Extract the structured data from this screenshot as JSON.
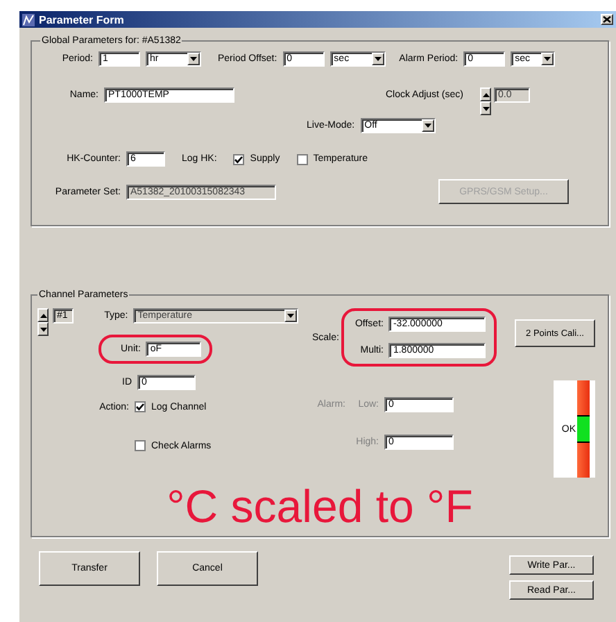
{
  "window": {
    "title": "Parameter Form"
  },
  "global": {
    "title": "Global Parameters for: #A51382",
    "period": {
      "label": "Period:",
      "value": "1",
      "unit": "hr"
    },
    "period_offset": {
      "label": "Period Offset:",
      "value": "0",
      "unit": "sec"
    },
    "alarm_period": {
      "label": "Alarm Period:",
      "value": "0",
      "unit": "sec"
    },
    "name": {
      "label": "Name:",
      "value": "PT1000TEMP"
    },
    "clock_adjust": {
      "label": "Clock Adjust (sec)",
      "value": "0.0",
      "disabled": true
    },
    "live_mode": {
      "label": "Live-Mode:",
      "value": "Off"
    },
    "hk_counter": {
      "label": "HK-Counter:",
      "value": "6"
    },
    "log_hk": {
      "label": "Log HK:",
      "options": [
        {
          "label": "Supply",
          "checked": true
        },
        {
          "label": "Temperature",
          "checked": false
        }
      ]
    },
    "parameter_set": {
      "label": "Parameter Set:",
      "value": "A51382_20100315082343",
      "disabled": true
    },
    "gprs_button": {
      "label": "GPRS/GSM Setup...",
      "disabled": true
    }
  },
  "channel": {
    "title": "Channel Parameters",
    "number": "#1",
    "type": {
      "label": "Type:",
      "value": "Temperature",
      "disabled": true
    },
    "unit": {
      "label": "Unit:",
      "value": "oF",
      "highlighted": true
    },
    "id": {
      "label": "ID",
      "value": "0"
    },
    "action": {
      "label": "Action:",
      "option": {
        "label": "Log Channel",
        "checked": true
      }
    },
    "check_alarms": {
      "label": "Check Alarms",
      "checked": false
    },
    "scale": {
      "label": "Scale:",
      "highlighted": true,
      "offset": {
        "label": "Offset:",
        "value": "-32.000000"
      },
      "multi": {
        "label": "Multi:",
        "value": "1.800000"
      }
    },
    "calibrate_button": {
      "label": "2 Points Cali..."
    },
    "alarm": {
      "label": "Alarm:",
      "disabled": true,
      "low": {
        "label": "Low:",
        "value": "0"
      },
      "high": {
        "label": "High:",
        "value": "0"
      }
    },
    "status_light": {
      "label": "OK"
    },
    "annotation": "°C scaled to °F"
  },
  "buttons": [
    {
      "label": "Transfer"
    },
    {
      "label": "Cancel"
    }
  ],
  "side_buttons": [
    {
      "label": "Write Par..."
    },
    {
      "label": "Read Par..."
    }
  ]
}
